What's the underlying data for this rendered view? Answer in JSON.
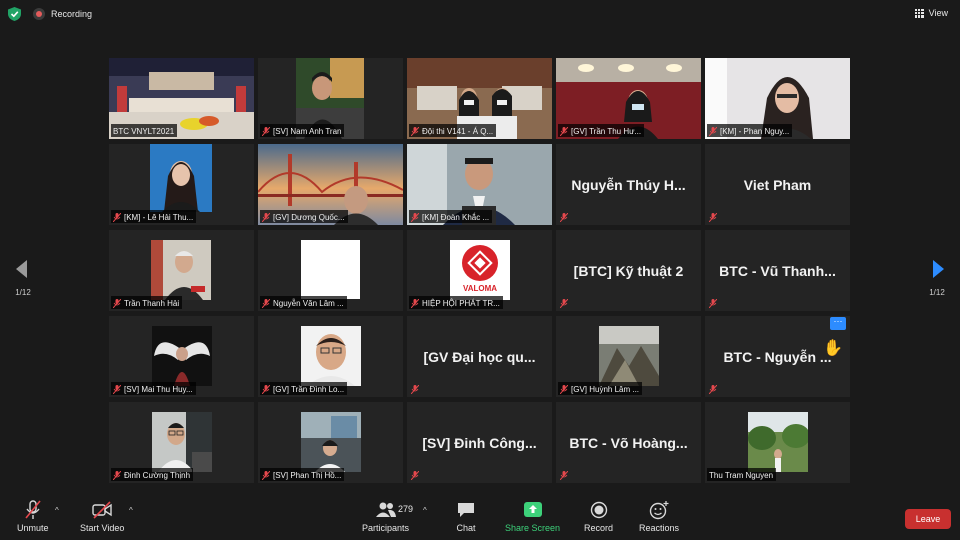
{
  "topbar": {
    "recording_label": "Recording",
    "view_label": "View"
  },
  "pager": {
    "left_page": "1/12",
    "right_page": "1/12"
  },
  "tiles": [
    {
      "name": "BTC VNYLT2021",
      "muted": false
    },
    {
      "name": "[SV] Nam Anh Tran",
      "muted": true
    },
    {
      "name": "Đội thi V141 - Á Q...",
      "muted": true
    },
    {
      "name": "[GV] Trần Thu Hư...",
      "muted": true
    },
    {
      "name": "[KM] - Phan Nguy...",
      "muted": true
    },
    {
      "name": "[KM] - Lê Hải Thu...",
      "muted": true
    },
    {
      "name": "[GV] Dương Quốc...",
      "muted": true
    },
    {
      "name": "[KM] Đoàn Khắc ...",
      "muted": true
    },
    {
      "name": "Nguyễn Thúy H...",
      "muted": true,
      "big": "Nguyễn Thúy H..."
    },
    {
      "name": "Viet Pham",
      "muted": true,
      "big": "Viet Pham"
    },
    {
      "name": "Trần Thanh Hải",
      "muted": true
    },
    {
      "name": "Nguyễn Văn Lâm ...",
      "muted": true
    },
    {
      "name": "HIỆP HỘI PHÁT TR...",
      "muted": true,
      "logo_text": "VALOMA"
    },
    {
      "name": "[BTC] Kỹ thuật 2",
      "muted": true,
      "big": "[BTC] Kỹ thuật 2"
    },
    {
      "name": "BTC - Vũ Thanh...",
      "muted": true,
      "big": "BTC - Vũ Thanh..."
    },
    {
      "name": "[SV] Mai Thu Huy...",
      "muted": true
    },
    {
      "name": "[GV] Trần Đình Lo...",
      "muted": true
    },
    {
      "name": "[GV Đại học qu...",
      "muted": true,
      "big": "[GV Đại học qu..."
    },
    {
      "name": "[GV] Huỳnh Lâm ...",
      "muted": true
    },
    {
      "name": "BTC - Nguyễn ...",
      "muted": true,
      "big": "BTC - Nguyễn ..."
    },
    {
      "name": "Đinh Cường Thịnh",
      "muted": true
    },
    {
      "name": "[SV] Phan Thị Hồ...",
      "muted": true
    },
    {
      "name": "[SV] Đinh Công...",
      "muted": true,
      "big": "[SV] Đinh Công..."
    },
    {
      "name": "BTC - Võ Hoàng...",
      "muted": true,
      "big": "BTC - Võ Hoàng..."
    },
    {
      "name": "Thu Tram Nguyen",
      "muted": false
    }
  ],
  "toolbar": {
    "unmute": "Unmute",
    "start_video": "Start Video",
    "participants": "Participants",
    "participant_count": "279",
    "chat": "Chat",
    "share_screen": "Share Screen",
    "record": "Record",
    "reactions": "Reactions",
    "leave": "Leave"
  },
  "colors": {
    "accent_green": "#3dd17a",
    "leave_red": "#c8302f",
    "active_speaker": "#d6e86e",
    "pager_blue": "#2d8cff"
  }
}
